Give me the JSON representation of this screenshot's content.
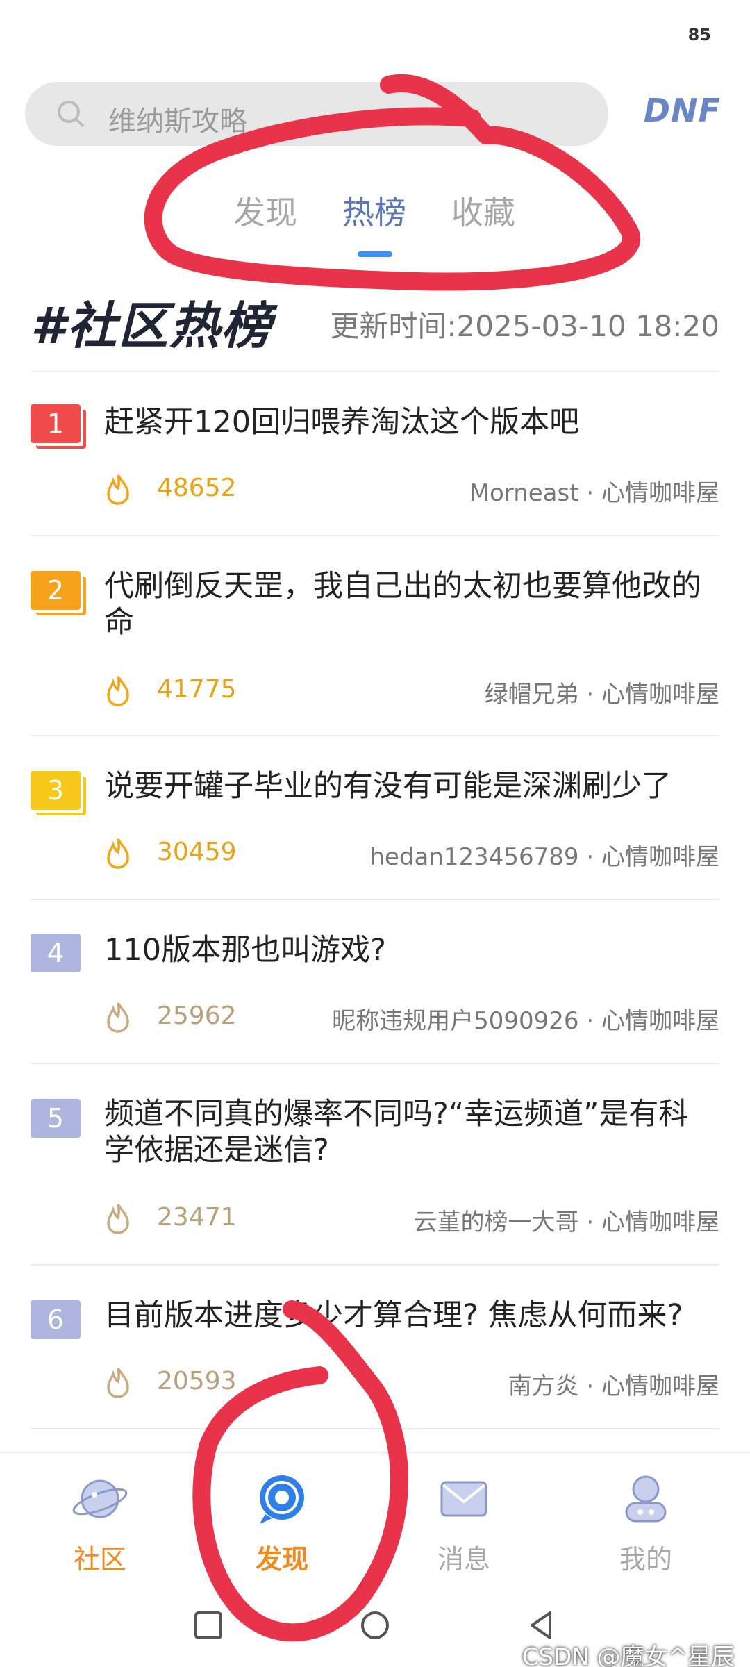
{
  "status_bar": {
    "battery": "85"
  },
  "search": {
    "placeholder": "维纳斯攻略",
    "logo": "DNF"
  },
  "tabs": [
    {
      "label": "发现",
      "active": false
    },
    {
      "label": "热榜",
      "active": true
    },
    {
      "label": "收藏",
      "active": false
    }
  ],
  "hot_board": {
    "title": "#社区热榜",
    "update_time": "更新时间:2025-03-10 18:20",
    "items": [
      {
        "rank": "1",
        "title": "赶紧开120回归喂养淘汰这个版本吧",
        "heat": "48652",
        "author": "Morneast",
        "board": "心情咖啡屋"
      },
      {
        "rank": "2",
        "title": "代刷倒反天罡，我自己出的太初也要算他改的命",
        "heat": "41775",
        "author": "绿帽兄弟",
        "board": "心情咖啡屋"
      },
      {
        "rank": "3",
        "title": "说要开罐子毕业的有没有可能是深渊刷少了",
        "heat": "30459",
        "author": "hedan123456789",
        "board": "心情咖啡屋"
      },
      {
        "rank": "4",
        "title": "110版本那也叫游戏?",
        "heat": "25962",
        "author": "昵称违规用户5090926",
        "board": "心情咖啡屋"
      },
      {
        "rank": "5",
        "title": "频道不同真的爆率不同吗?“幸运频道”是有科学依据还是迷信?",
        "heat": "23471",
        "author": "云堇的榜一大哥",
        "board": "心情咖啡屋"
      },
      {
        "rank": "6",
        "title": "目前版本进度多少才算合理? 焦虑从何而来?",
        "heat": "20593",
        "author": "南方炎",
        "board": "心情咖啡屋"
      }
    ],
    "separator": "·"
  },
  "bottom_nav": [
    {
      "label": "社区",
      "icon": "planet-icon",
      "active": false
    },
    {
      "label": "发现",
      "icon": "discover-icon",
      "active": true
    },
    {
      "label": "消息",
      "icon": "mail-icon",
      "active": false
    },
    {
      "label": "我的",
      "icon": "profile-icon",
      "active": false
    }
  ],
  "watermark": "CSDN @魔女^星辰",
  "colors": {
    "active_tab": "#5a76b8",
    "tab_indicator": "#3b8ef2",
    "nav_active": "#f08a1c",
    "rank1": "#f04a4a",
    "rank2": "#f7a21b",
    "rank3": "#f5c81a",
    "rank_other": "#aeb6e0",
    "annotation": "#e8334a"
  }
}
